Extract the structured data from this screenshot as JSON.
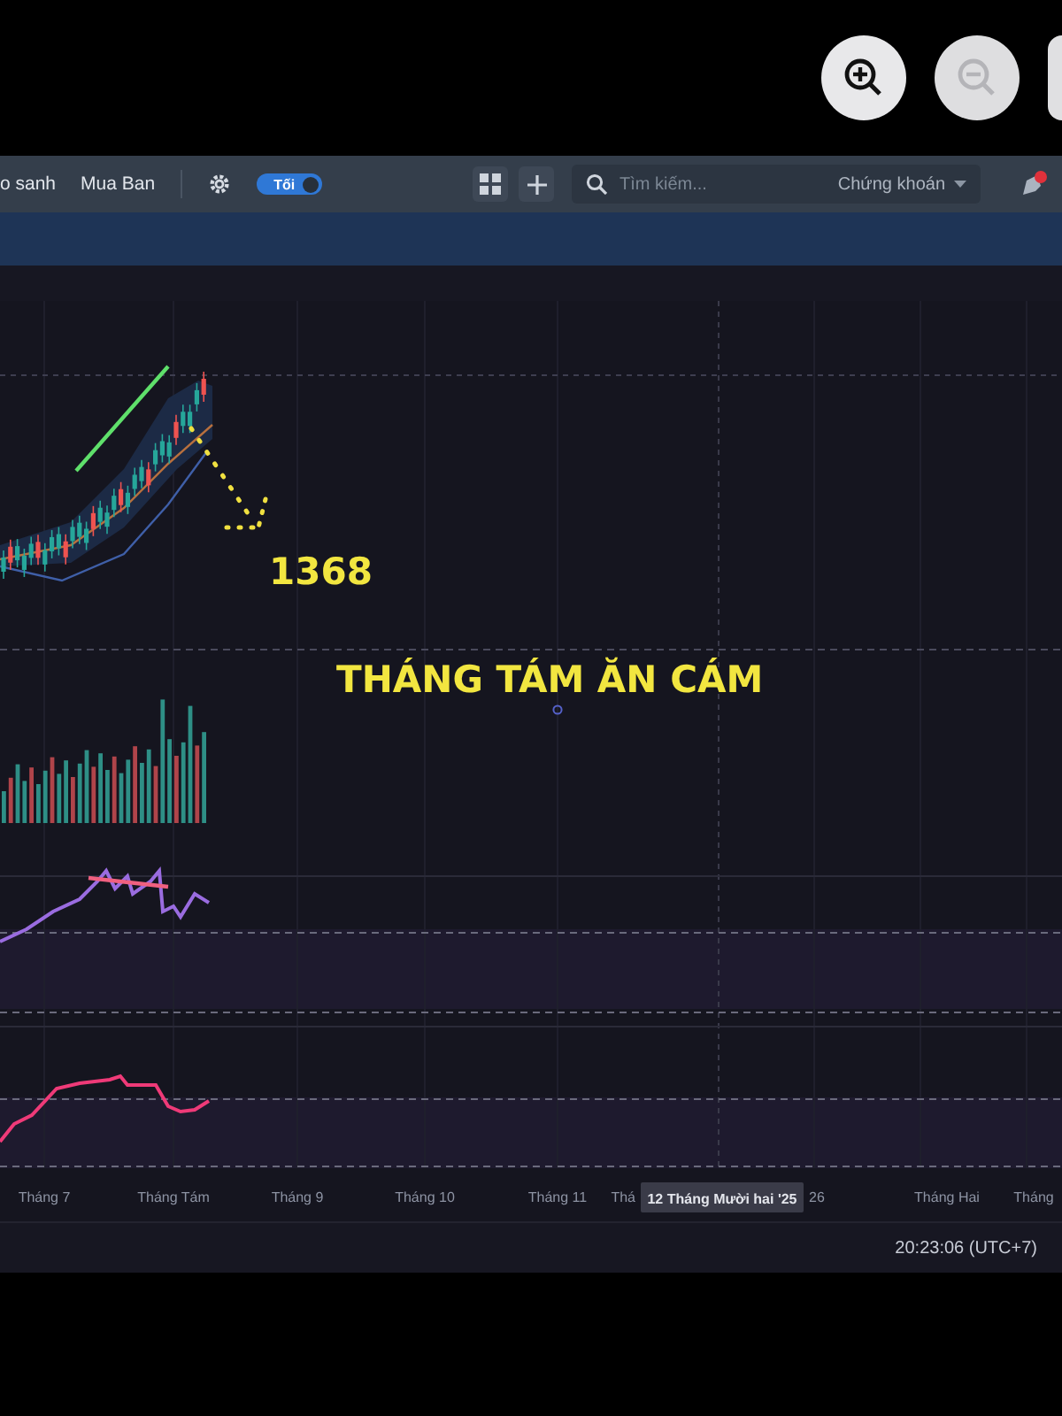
{
  "viewer_controls": [
    {
      "kind": "zoom-in",
      "disabled": false
    },
    {
      "kind": "zoom-out",
      "disabled": true
    }
  ],
  "toolbar": {
    "links": [
      "o sanh",
      "Mua Ban"
    ],
    "theme_toggle": {
      "label": "Tối",
      "on": true
    },
    "search": {
      "placeholder": "Tìm kiếm...",
      "market": "Chứng khoán"
    }
  },
  "chart": {
    "annotations": [
      "1368",
      "THÁNG TÁM ĂN CÁM"
    ],
    "time_axis": [
      "Tháng 7",
      "Tháng Tám",
      "Tháng 9",
      "Tháng 10",
      "Tháng 11",
      "Thá",
      "26",
      "Tháng Hai",
      "Tháng"
    ],
    "crosshair_label": "12 Tháng Mười hai '25"
  },
  "status_bar": {
    "clock": "20:23:06 (UTC+7)"
  }
}
